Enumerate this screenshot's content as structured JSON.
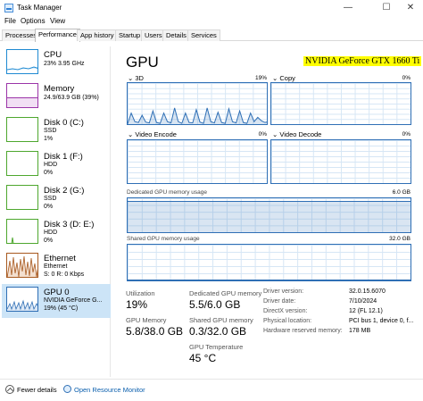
{
  "window": {
    "title": "Task Manager",
    "minimize": "—",
    "maximize": "☐",
    "close": "✕"
  },
  "menu": [
    "File",
    "Options",
    "View"
  ],
  "tabs": [
    "Processes",
    "Performance",
    "App history",
    "Startup",
    "Users",
    "Details",
    "Services"
  ],
  "active_tab": "Performance",
  "sidebar": [
    {
      "name": "CPU",
      "line1": "23%  3.95 GHz",
      "line2": ""
    },
    {
      "name": "Memory",
      "line1": "24.9/63.9 GB (39%)",
      "line2": ""
    },
    {
      "name": "Disk 0 (C:)",
      "line1": "SSD",
      "line2": "1%"
    },
    {
      "name": "Disk 1 (F:)",
      "line1": "HDD",
      "line2": "0%"
    },
    {
      "name": "Disk 2 (G:)",
      "line1": "SSD",
      "line2": "0%"
    },
    {
      "name": "Disk 3 (D: E:)",
      "line1": "HDD",
      "line2": "0%"
    },
    {
      "name": "Ethernet",
      "line1": "Ethernet",
      "line2": "S: 0  R: 0 Kbps"
    },
    {
      "name": "GPU 0",
      "line1": "NVIDIA GeForce G...",
      "line2": "19%  (45 °C)"
    }
  ],
  "colors": {
    "cpu": "#1f8ad2",
    "memory": "#9b34a8",
    "disk": "#4ea72e",
    "ethernet": "#a7581e",
    "gpu": "#2f6fb5",
    "highlight": "#ffff00",
    "selected": "#cce4f7"
  },
  "main": {
    "title": "GPU",
    "gpu_name": "NVIDIA GeForce GTX 1660 Ti",
    "engines": [
      {
        "label": "3D",
        "pct": "19%"
      },
      {
        "label": "Copy",
        "pct": "0%"
      },
      {
        "label": "Video Encode",
        "pct": "0%"
      },
      {
        "label": "Video Decode",
        "pct": "0%"
      }
    ],
    "dedicated_label": "Dedicated GPU memory usage",
    "dedicated_max": "6.0 GB",
    "shared_label": "Shared GPU memory usage",
    "shared_max": "32.0 GB",
    "stats": {
      "utilization_label": "Utilization",
      "utilization": "19%",
      "gpu_memory_label": "GPU Memory",
      "gpu_memory": "5.8/38.0 GB",
      "dedicated_mem_label": "Dedicated GPU memory",
      "dedicated_mem": "5.5/6.0 GB",
      "shared_mem_label": "Shared GPU memory",
      "shared_mem": "0.3/32.0 GB",
      "temp_label": "GPU Temperature",
      "temp": "45 °C"
    },
    "info": [
      {
        "label": "Driver version:",
        "value": "32.0.15.6070"
      },
      {
        "label": "Driver date:",
        "value": "7/10/2024"
      },
      {
        "label": "DirectX version:",
        "value": "12 (FL 12.1)"
      },
      {
        "label": "Physical location:",
        "value": "PCI bus 1, device 0, f..."
      },
      {
        "label": "Hardware reserved memory:",
        "value": "178 MB"
      }
    ],
    "series_3d": [
      0.05,
      0.3,
      0.1,
      0.08,
      0.25,
      0.09,
      0.07,
      0.35,
      0.08,
      0.06,
      0.3,
      0.1,
      0.07,
      0.42,
      0.1,
      0.06,
      0.3,
      0.08,
      0.07,
      0.38,
      0.09,
      0.06,
      0.42,
      0.1,
      0.07,
      0.32,
      0.08,
      0.06,
      0.4,
      0.1,
      0.07,
      0.35,
      0.08,
      0.06,
      0.3,
      0.1,
      0.2,
      0.12,
      0.08,
      0.1
    ],
    "dedicated_level": 0.92,
    "shared_level": 0.01
  },
  "footer": {
    "fewer": "Fewer details",
    "open_rm": "Open Resource Monitor"
  }
}
